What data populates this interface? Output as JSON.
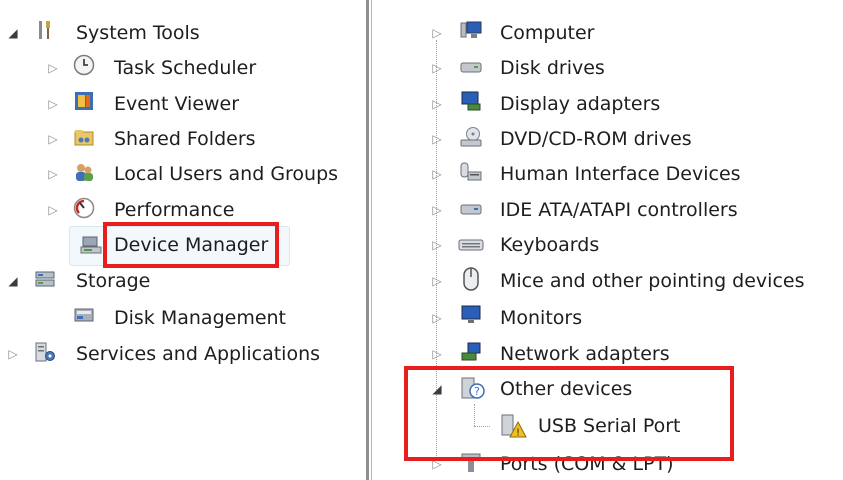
{
  "left_tree": {
    "system_tools": "System Tools",
    "task_scheduler": "Task Scheduler",
    "event_viewer": "Event Viewer",
    "shared_folders": "Shared Folders",
    "local_users": "Local Users and Groups",
    "performance": "Performance",
    "device_manager": "Device Manager",
    "storage": "Storage",
    "disk_management": "Disk Management",
    "services": "Services and Applications"
  },
  "device_tree": {
    "computer": "Computer",
    "disk_drives": "Disk drives",
    "display_adapters": "Display adapters",
    "dvd_drives": "DVD/CD-ROM drives",
    "hid": "Human Interface Devices",
    "ide": "IDE ATA/ATAPI controllers",
    "keyboards": "Keyboards",
    "mice": "Mice and other pointing devices",
    "monitors": "Monitors",
    "network": "Network adapters",
    "other": "Other devices",
    "usb_serial": "USB Serial Port",
    "ports": "Ports (COM & LPT)"
  },
  "colors": {
    "annotation": "#e81e1e",
    "selection": "#f3f8fd"
  }
}
